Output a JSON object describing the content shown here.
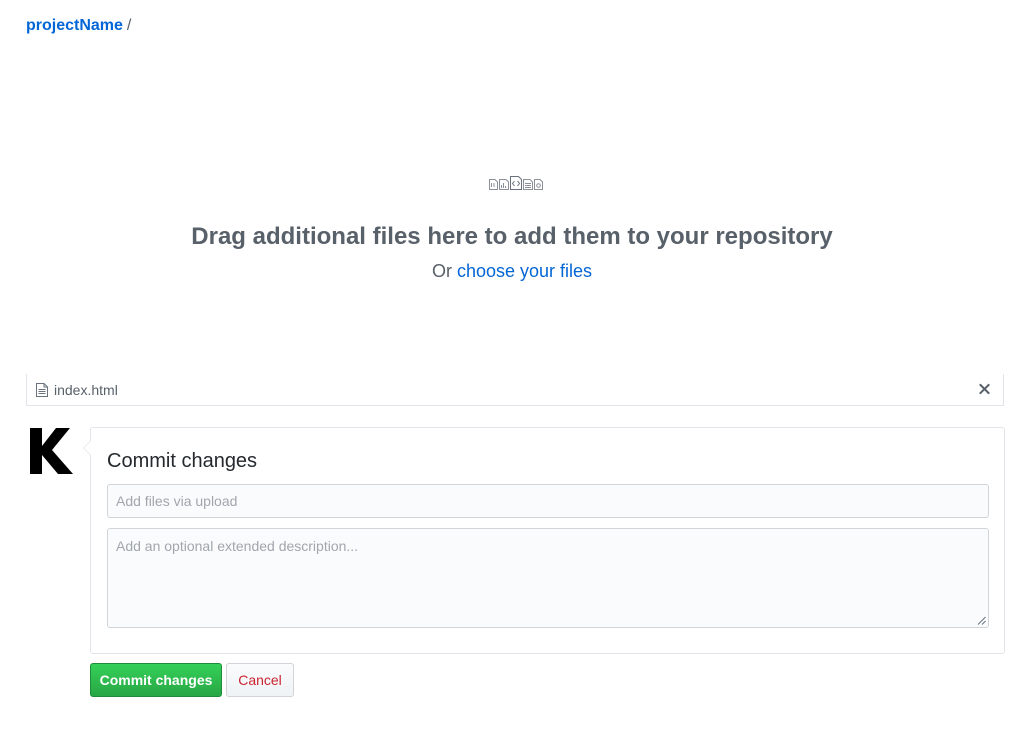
{
  "breadcrumb": {
    "repo": "projectName",
    "separator": "/"
  },
  "dropzone": {
    "title": "Drag additional files here to add them to your repository",
    "prefix": "Or",
    "link": "choose your files",
    "icons": [
      "file-binary-icon",
      "file-chart-icon",
      "file-code-icon",
      "file-text-icon",
      "file-media-icon"
    ]
  },
  "file": {
    "name": "index.html",
    "icon": "file-icon",
    "remove_icon": "close-icon"
  },
  "commit": {
    "avatar_letter": "K",
    "title": "Commit changes",
    "summary_placeholder": "Add files via upload",
    "description_placeholder": "Add an optional extended description...",
    "commit_label": "Commit changes",
    "cancel_label": "Cancel"
  },
  "colors": {
    "link": "#0366d6",
    "primary_button": "#28a745",
    "danger_text": "#cb2431",
    "muted_text": "#586069"
  }
}
